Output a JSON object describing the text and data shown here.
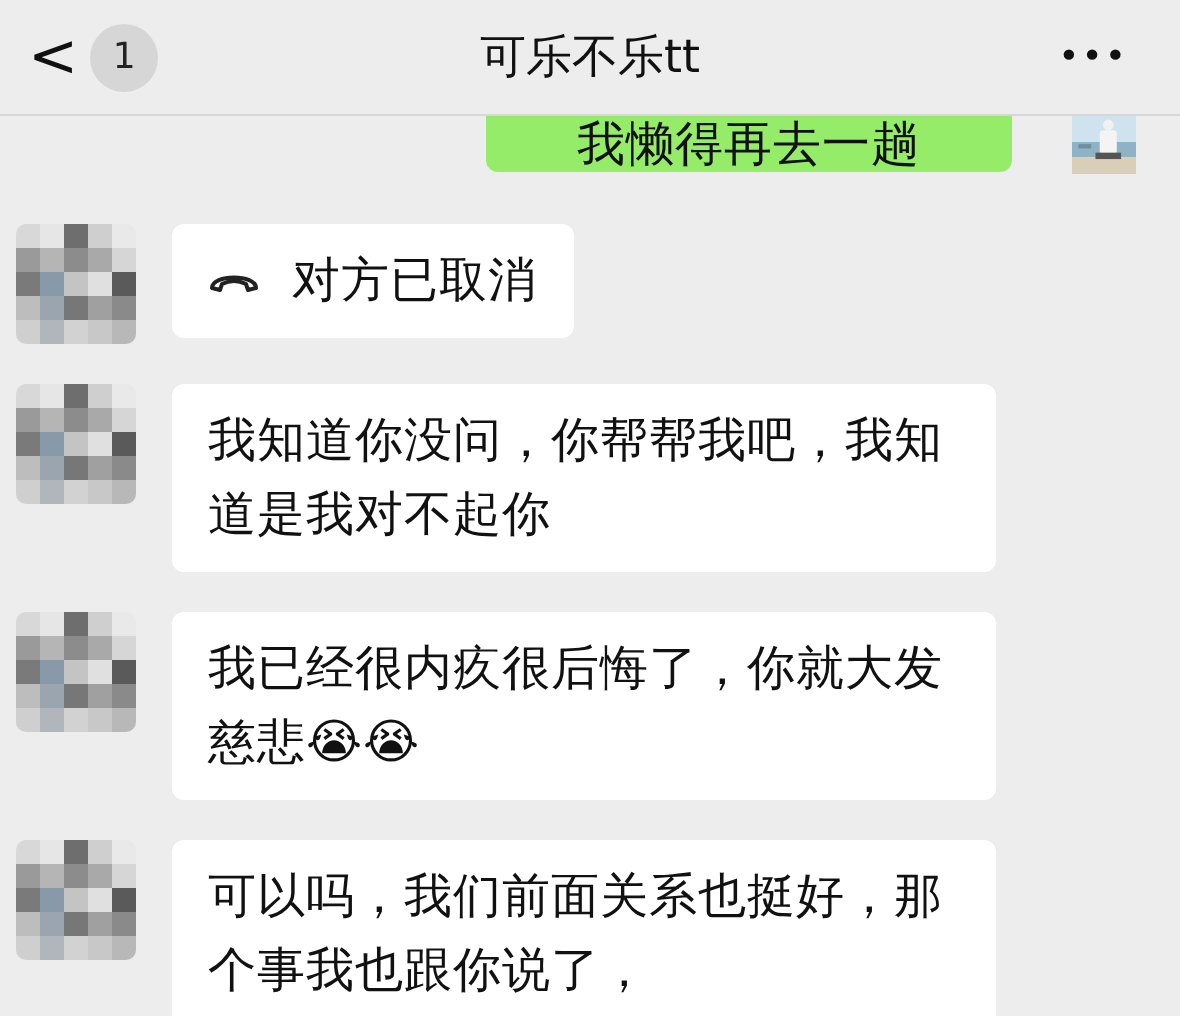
{
  "header": {
    "back_icon": "<",
    "unread_count": "1",
    "title": "可乐不乐tt",
    "more": "•••"
  },
  "messages": [
    {
      "sent": true,
      "kind": "text",
      "text": "我懒得再去一趟"
    },
    {
      "sent": false,
      "kind": "call",
      "text": "对方已取消"
    },
    {
      "sent": false,
      "kind": "text",
      "text": "我知道你没问，你帮帮我吧，我知道是我对不起你"
    },
    {
      "sent": false,
      "kind": "text",
      "text": "我已经很内疚很后悔了，你就大发慈悲😭😭"
    },
    {
      "sent": false,
      "kind": "text",
      "text": "可以吗，我们前面关系也挺好，那个事我也跟你说了，"
    }
  ]
}
